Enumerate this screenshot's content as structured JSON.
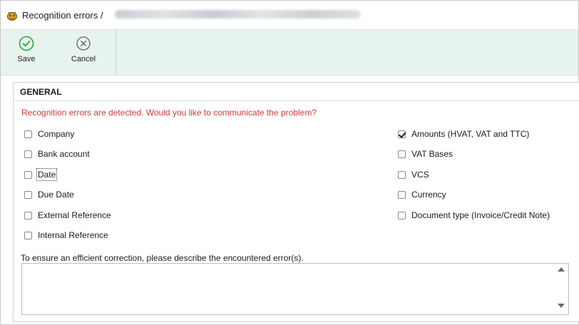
{
  "window": {
    "title": "Recognition errors /"
  },
  "toolbar": {
    "save_label": "Save",
    "cancel_label": "Cancel"
  },
  "general": {
    "section_title": "GENERAL",
    "warning": "Recognition errors are detected. Would you like to communicate the problem?",
    "left_checkboxes": [
      {
        "label": "Company",
        "checked": false
      },
      {
        "label": "Bank account",
        "checked": false
      },
      {
        "label": "Date",
        "checked": false
      },
      {
        "label": "Due Date",
        "checked": false
      },
      {
        "label": "External Reference",
        "checked": false
      },
      {
        "label": "Internal Reference",
        "checked": false
      }
    ],
    "right_checkboxes": [
      {
        "label": "Amounts (HVAT, VAT and TTC)",
        "checked": true
      },
      {
        "label": "VAT Bases",
        "checked": false
      },
      {
        "label": "VCS",
        "checked": false
      },
      {
        "label": "Currency",
        "checked": false
      },
      {
        "label": "Document type (Invoice/Credit Note)",
        "checked": false
      }
    ],
    "description_label": "To ensure an efficient correction, please describe the encountered error(s).",
    "description_value": ""
  },
  "colors": {
    "toolbar_bg": "#e7f4ee",
    "save_icon": "#2ea043",
    "warning_text": "#d13a3a"
  },
  "icons": {
    "app": "app-bug-icon",
    "save": "check-circle-icon",
    "cancel": "x-circle-icon"
  }
}
